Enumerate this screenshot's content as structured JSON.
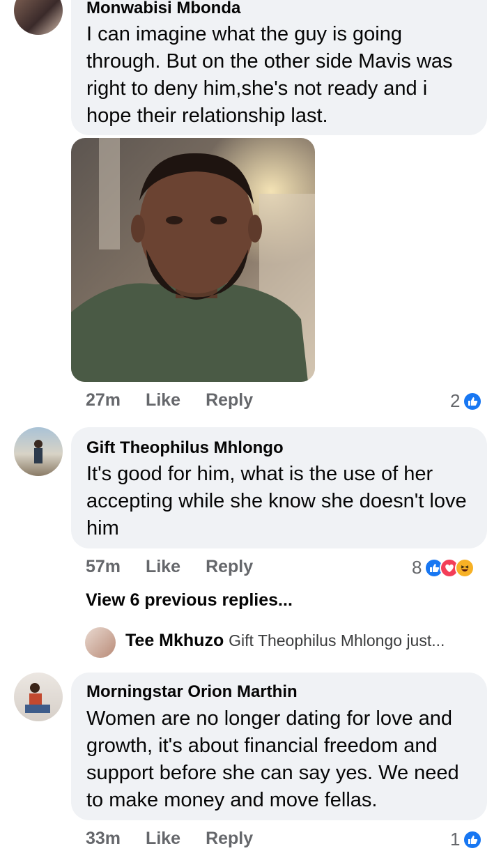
{
  "comments": [
    {
      "author": "Monwabisi Mbonda",
      "text": "I can imagine what the guy is going through. But on the other side Mavis was right to deny him,she's not ready and i hope their relationship last.",
      "time": "27m",
      "like_label": "Like",
      "reply_label": "Reply",
      "reaction_count": "2",
      "reactions": [
        "like-icon"
      ]
    },
    {
      "author": "Gift Theophilus Mhlongo",
      "text": "It's good for him, what is the use of her accepting while she know she doesn't love him",
      "time": "57m",
      "like_label": "Like",
      "reply_label": "Reply",
      "reaction_count": "8",
      "reactions": [
        "like-icon",
        "love-icon",
        "haha-icon"
      ],
      "view_previous": "View 6 previous replies...",
      "reply_preview": {
        "author": "Tee Mkhuzo",
        "text": "Gift Theophilus Mhlongo just..."
      }
    },
    {
      "author": "Morningstar Orion Marthin",
      "text": "Women are no longer dating for love and growth, it's about financial freedom and support before she can say yes. We need to make money and move fellas.",
      "time": "33m",
      "like_label": "Like",
      "reply_label": "Reply",
      "reaction_count": "1",
      "reactions": [
        "like-icon"
      ]
    }
  ],
  "colors": {
    "bubble": "#f0f2f5",
    "meta_text": "#65676b",
    "like_blue": "#1877f2",
    "love_red": "#f33e58",
    "haha_yellow": "#f7b125"
  }
}
